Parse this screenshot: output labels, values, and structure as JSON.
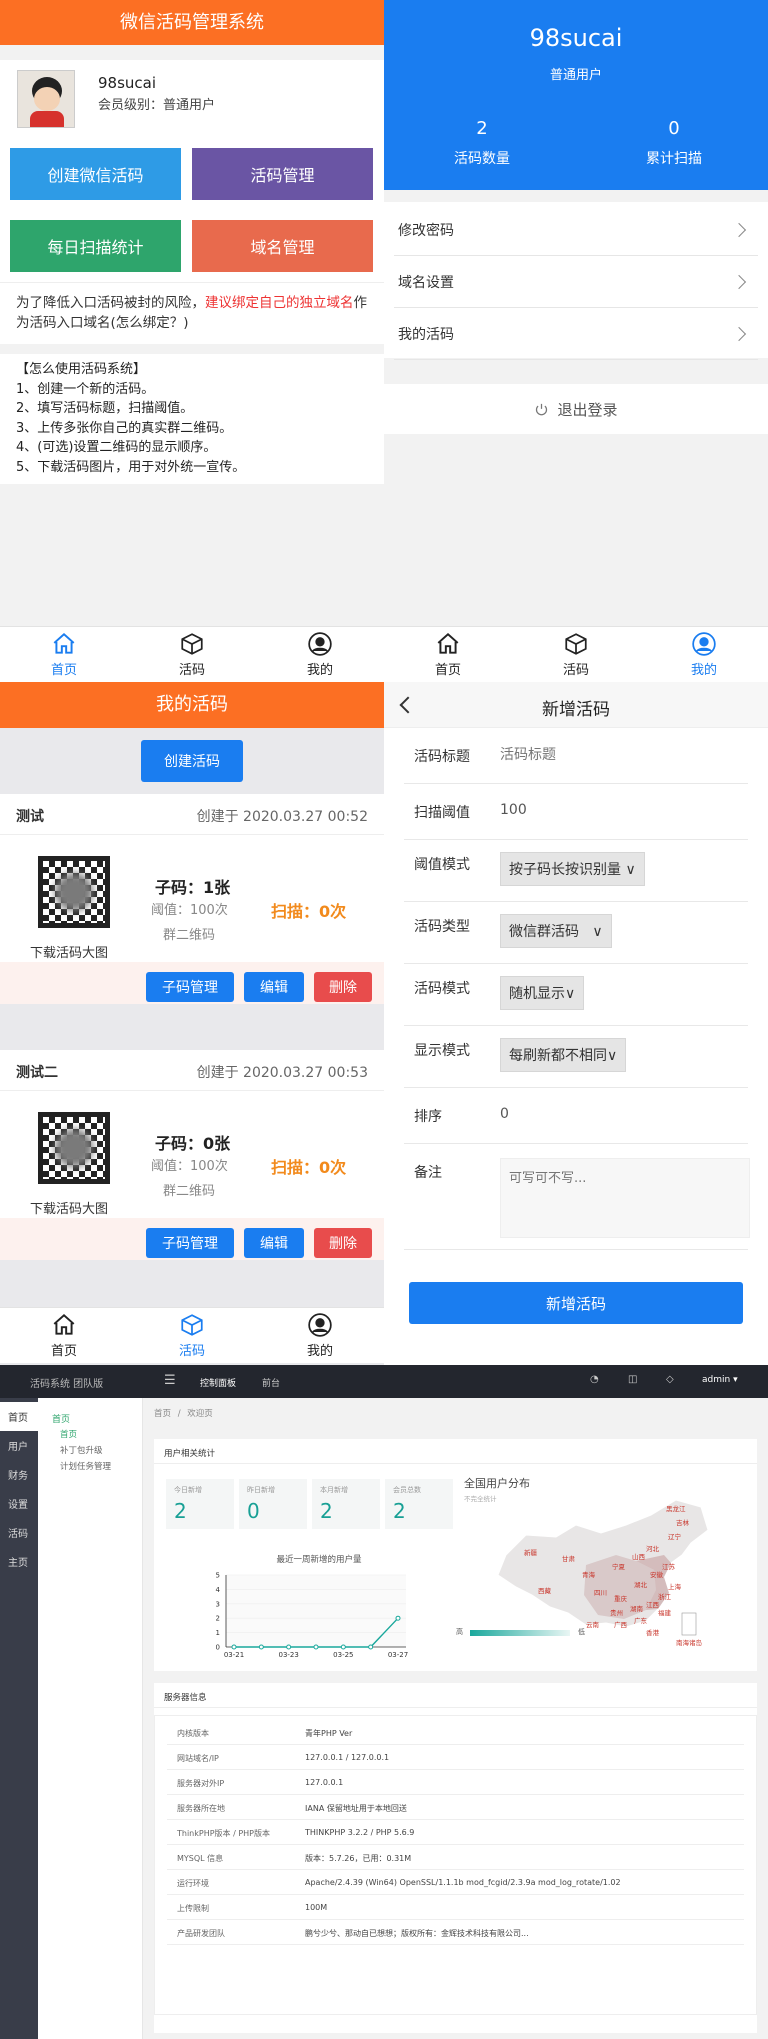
{
  "p1": {
    "header": "微信活码管理系统",
    "username": "98sucai",
    "member_level": "会员级别：普通用户",
    "tiles": [
      "创建微信活码",
      "活码管理",
      "每日扫描统计",
      "域名管理"
    ],
    "tile_colors": [
      "#2e9be6",
      "#6a55a4",
      "#2ea56c",
      "#e86a4d"
    ],
    "notice_pre": "为了降低入口活码被封的风险，",
    "notice_red": "建议绑定自己的独立域名",
    "notice_post": "作为活码入口域名(怎么绑定？)",
    "howto": [
      "【怎么使用活码系统】",
      "1、创建一个新的活码。",
      "2、填写活码标题，扫描阈值。",
      "3、上传多张你自己的真实群二维码。",
      "4、(可选)设置二维码的显示顺序。",
      "5、下载活码图片，用于对外统一宣传。"
    ],
    "tabs": [
      "首页",
      "活码",
      "我的"
    ]
  },
  "p2": {
    "username": "98sucai",
    "role": "普通用户",
    "stat1_value": "2",
    "stat1_label": "活码数量",
    "stat2_value": "0",
    "stat2_label": "累计扫描",
    "menu": [
      "修改密码",
      "域名设置",
      "我的活码"
    ],
    "logout": "退出登录",
    "tabs": [
      "首页",
      "活码",
      "我的"
    ],
    "accent": "#1a7df0"
  },
  "p3": {
    "header": "我的活码",
    "create_button": "创建活码",
    "cards": [
      {
        "title": "测试",
        "created": "创建于 2020.03.27 00:52",
        "sub": "子码：1张",
        "threshold": "阈值：100次",
        "group": "群二维码",
        "scan": "扫描：0次",
        "download": "下载活码大图"
      },
      {
        "title": "测试二",
        "created": "创建于 2020.03.27 00:53",
        "sub": "子码：0张",
        "threshold": "阈值：100次",
        "group": "群二维码",
        "scan": "扫描：0次",
        "download": "下载活码大图"
      }
    ],
    "actions": [
      "子码管理",
      "编辑",
      "删除"
    ],
    "tabs": [
      "首页",
      "活码",
      "我的"
    ]
  },
  "p4": {
    "header": "新增活码",
    "fields": {
      "title_label": "活码标题",
      "title_placeholder": "活码标题",
      "threshold_label": "扫描阈值",
      "threshold_value": "100",
      "mode_label": "阈值模式",
      "mode_value": "按子码长按识别量",
      "type_label": "活码类型",
      "type_value": "微信群活码",
      "pattern_label": "活码模式",
      "pattern_value": "随机显示",
      "display_label": "显示模式",
      "display_value": "每刷新都不相同",
      "order_label": "排序",
      "order_value": "0",
      "remark_label": "备注",
      "remark_placeholder": "可写可不写..."
    },
    "submit": "新增活码"
  },
  "admin": {
    "brand": "活码系统 团队版",
    "topnav": [
      "控制面板",
      "前台"
    ],
    "user": "admin",
    "sidebar": [
      "首页",
      "用户",
      "财务",
      "设置",
      "活码",
      "主页"
    ],
    "subnav_title": "首页",
    "subnav_items": [
      "首页",
      "补丁包升级",
      "计划任务管理"
    ],
    "breadcrumb_home": "首页",
    "breadcrumb_sep": "/",
    "breadcrumb_current": "欢迎页",
    "user_stats_title": "用户相关统计",
    "stats": [
      {
        "label": "今日新增",
        "value": "2"
      },
      {
        "label": "昨日新增",
        "value": "0"
      },
      {
        "label": "本月新增",
        "value": "2"
      },
      {
        "label": "会员总数",
        "value": "2"
      }
    ],
    "map_title": "全国用户分布",
    "map_subtitle": "不完全统计",
    "legend_high": "高",
    "legend_low": "低",
    "map_provinces": [
      "黑龙江",
      "吉林",
      "辽宁",
      "新疆",
      "甘肃",
      "宁夏",
      "山西",
      "河北",
      "青海",
      "西藏",
      "四川",
      "重庆",
      "湖北",
      "安徽",
      "江苏",
      "上海",
      "浙江",
      "江西",
      "湖南",
      "贵州",
      "广西",
      "广东",
      "云南",
      "香港",
      "福建",
      "南海诸岛"
    ],
    "server_title": "服务器信息",
    "server_rows": [
      {
        "k": "内核版本",
        "v": "青年PHP Ver"
      },
      {
        "k": "网站域名/IP",
        "v": "127.0.0.1 / 127.0.0.1"
      },
      {
        "k": "服务器对外IP",
        "v": "127.0.0.1"
      },
      {
        "k": "服务器所在地",
        "v": "IANA 保留地址用于本地回送"
      },
      {
        "k": "ThinkPHP版本 / PHP版本",
        "v": "THINKPHP 3.2.2 / PHP 5.6.9"
      },
      {
        "k": "MYSQL 信息",
        "v": "版本：5.7.26，已用：0.31M"
      },
      {
        "k": "运行环境",
        "v": "Apache/2.4.39 (Win64) OpenSSL/1.1.1b mod_fcgid/2.3.9a mod_log_rotate/1.02"
      },
      {
        "k": "上传限制",
        "v": "100M"
      },
      {
        "k": "产品研发团队",
        "v": "鹏兮少兮、那动自已想想；版权所有：金辉技术科技有限公司..."
      }
    ]
  },
  "chart_data": {
    "type": "line",
    "title": "最近一周新增的用户量",
    "x": [
      "03-21",
      "03-22",
      "03-23",
      "03-24",
      "03-25",
      "03-26",
      "03-27"
    ],
    "x_ticks": [
      "03-21",
      "03-23",
      "03-25",
      "03-27"
    ],
    "values": [
      0,
      0,
      0,
      0,
      0,
      0,
      2
    ],
    "ylim": [
      0,
      5
    ],
    "y_ticks": [
      "0",
      "1",
      "2",
      "3",
      "4",
      "5"
    ],
    "color": "#1aa89c"
  }
}
